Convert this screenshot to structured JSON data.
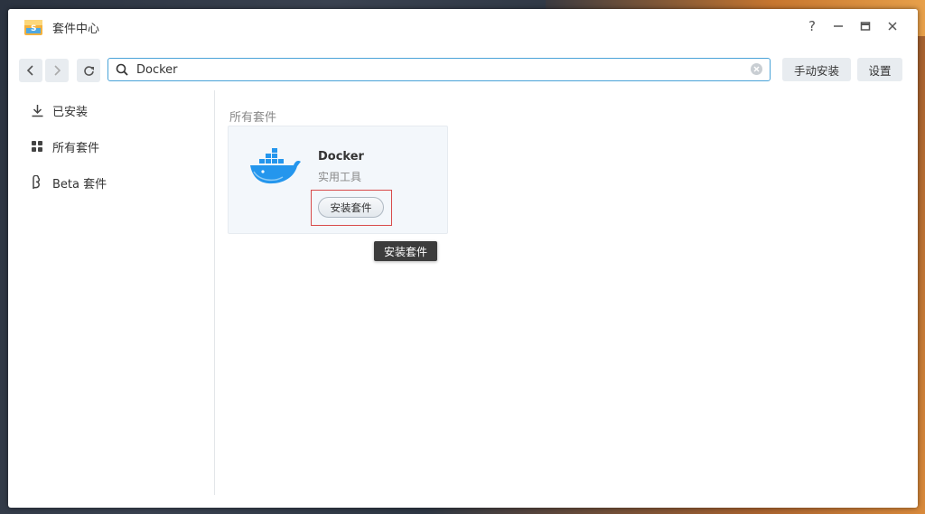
{
  "window": {
    "title": "套件中心",
    "controls": [
      "?",
      "—",
      "□",
      "✕"
    ]
  },
  "toolbar": {
    "back_icon": "chevron-left-icon",
    "forward_icon": "chevron-right-icon",
    "refresh_icon": "refresh-icon",
    "search_value": "Docker",
    "manual_install_label": "手动安装",
    "settings_label": "设置"
  },
  "sidebar": {
    "items": [
      {
        "label": "已安装",
        "icon": "download-icon"
      },
      {
        "label": "所有套件",
        "icon": "grid-icon"
      },
      {
        "label": "Beta 套件",
        "icon": "beta-icon"
      }
    ]
  },
  "main": {
    "section_title": "所有套件",
    "package": {
      "name": "Docker",
      "category": "实用工具",
      "install_label": "安装套件",
      "icon": "docker-whale-icon"
    },
    "tooltip": "安装套件"
  },
  "colors": {
    "accent": "#4aa3d8",
    "highlight": "#d84a4a",
    "docker_blue": "#2496ed"
  }
}
